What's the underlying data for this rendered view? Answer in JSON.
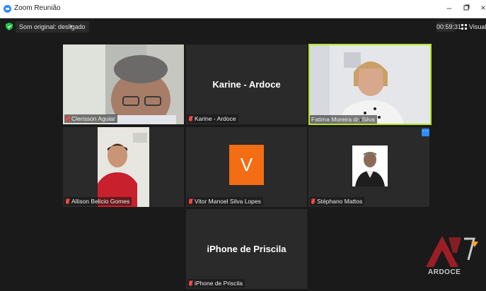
{
  "window": {
    "title": "Zoom Reunião"
  },
  "toolbar": {
    "audio_label": "Som original: desligado",
    "caret": "▾"
  },
  "meeting": {
    "timer": "00:59:31",
    "view_label": "Visualizar"
  },
  "participants": [
    {
      "name": "Clerisson Aguiar",
      "muted": true,
      "video": true
    },
    {
      "name": "Karine - Ardoce",
      "muted": true,
      "video": false
    },
    {
      "name": "Fatima Moreira da Silva",
      "muted": false,
      "video": true,
      "speaking": true
    },
    {
      "name": "Allison Belicio Gomes",
      "muted": true,
      "video": true
    },
    {
      "name": "Vitor Manoel Silva Lopes",
      "muted": true,
      "video": false,
      "avatar_letter": "V"
    },
    {
      "name": "Stéphano Mattos",
      "muted": true,
      "video": true
    },
    {
      "name": "iPhone de Priscila",
      "muted": true,
      "video": false
    }
  ],
  "more_button": "···",
  "watermark": {
    "text": "ARDOCE"
  },
  "colors": {
    "speaking_border": "#b5e61d",
    "avatar_bg": "#f26d14",
    "accent": "#2d8cff",
    "muted_icon": "#e03a3a"
  }
}
